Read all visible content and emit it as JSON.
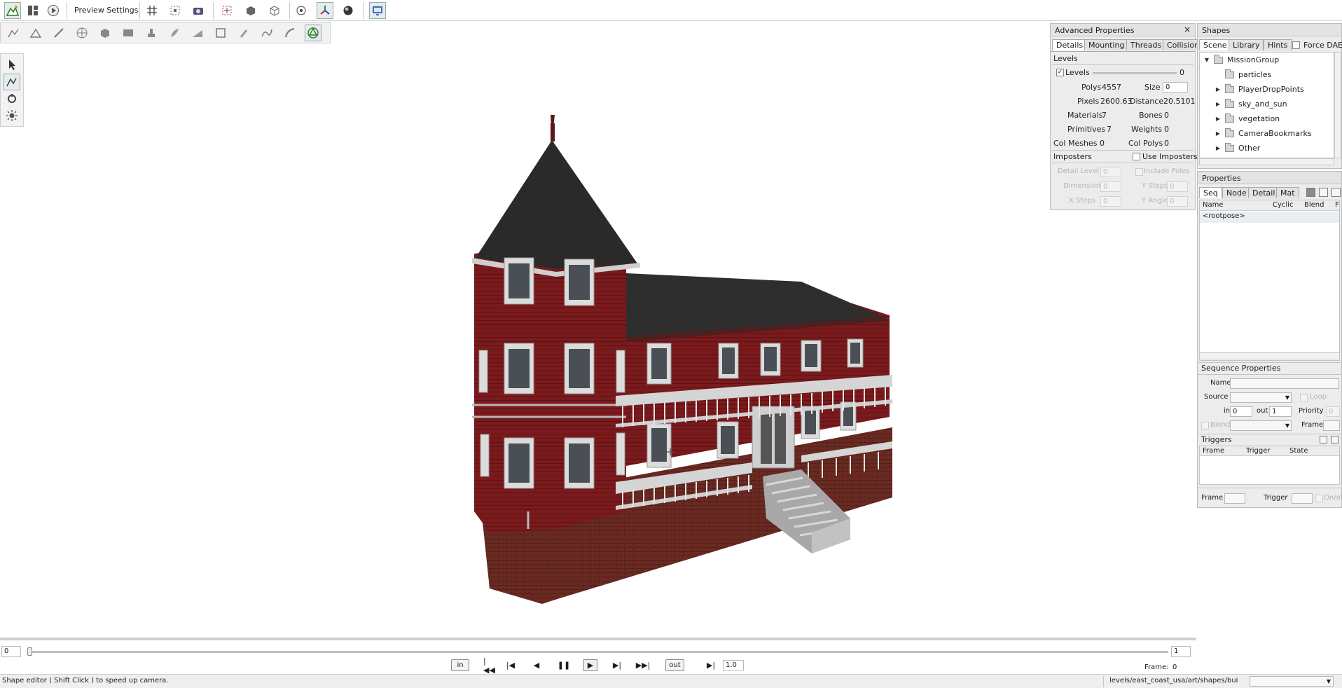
{
  "toolbar": {
    "preview_settings": "Preview Settings"
  },
  "advanced": {
    "title": "Advanced Properties",
    "close_icon": "×",
    "tabs": [
      "Details",
      "Mounting",
      "Threads",
      "Collision"
    ],
    "levels_header": "Levels",
    "levels_label": "Levels",
    "levels_value": "0",
    "polys_label": "Polys",
    "polys_value": "4557",
    "size_label": "Size",
    "size_value": "0",
    "pixels_label": "Pixels",
    "pixels_value": "2600.63",
    "distance_label": "Distance",
    "distance_value": "20.5101",
    "materials_label": "Materials",
    "materials_value": "7",
    "bones_label": "Bones",
    "bones_value": "0",
    "primitives_label": "Primitives",
    "primitives_value": "7",
    "weights_label": "Weights",
    "weights_value": "0",
    "colmeshes_label": "Col Meshes",
    "colmeshes_value": "0",
    "colpolys_label": "Col Polys",
    "colpolys_value": "0",
    "imposters_header": "Imposters",
    "use_imposters": "Use Imposters",
    "detail_level": "Detail Level",
    "detail_level_value": "0",
    "include_poles": "Include Poles",
    "dimension": "Dimension",
    "dimension_value": "0",
    "ysteps": "Y Steps",
    "ysteps_value": "0",
    "xsteps": "X Steps",
    "xsteps_value": "0",
    "yangle": "Y Angle",
    "yangle_value": "0"
  },
  "shapes": {
    "title": "Shapes",
    "tabs": [
      "Scene",
      "Library",
      "Hints"
    ],
    "force_dae": "Force DAE",
    "tree": [
      "MissionGroup",
      "particles",
      "PlayerDropPoints",
      "sky_and_sun",
      "vegetation",
      "CameraBookmarks",
      "Other"
    ]
  },
  "properties": {
    "title": "Properties",
    "tabs": [
      "Seq",
      "Node",
      "Detail",
      "Mat"
    ],
    "columns": [
      "Name",
      "Cyclic",
      "Blend",
      "F"
    ],
    "rows": [
      "<rootpose>"
    ],
    "seq_props_title": "Sequence Properties",
    "name_label": "Name",
    "source_label": "Source",
    "loop_label": "Loop",
    "in_label": "in",
    "in_value": "0",
    "out_label": "out",
    "out_value": "1",
    "priority_label": "Priority",
    "priority_value": "0",
    "blend_label": "Blend",
    "frame_label": "Frame",
    "triggers_title": "Triggers",
    "trigger_columns": [
      "Frame",
      "Trigger",
      "State"
    ],
    "bottom_frame": "Frame",
    "bottom_trigger": "Trigger",
    "onoff": "On/off"
  },
  "timeline": {
    "start": "0",
    "end": "1",
    "in_button": "in",
    "out_button": "out",
    "speed": "1.0",
    "frame_label": "Frame:",
    "frame_value": "0"
  },
  "status": {
    "message": "Shape editor ( Shift Click ) to speed up camera.",
    "path": "levels/east_coast_usa/art/shapes/bui"
  }
}
